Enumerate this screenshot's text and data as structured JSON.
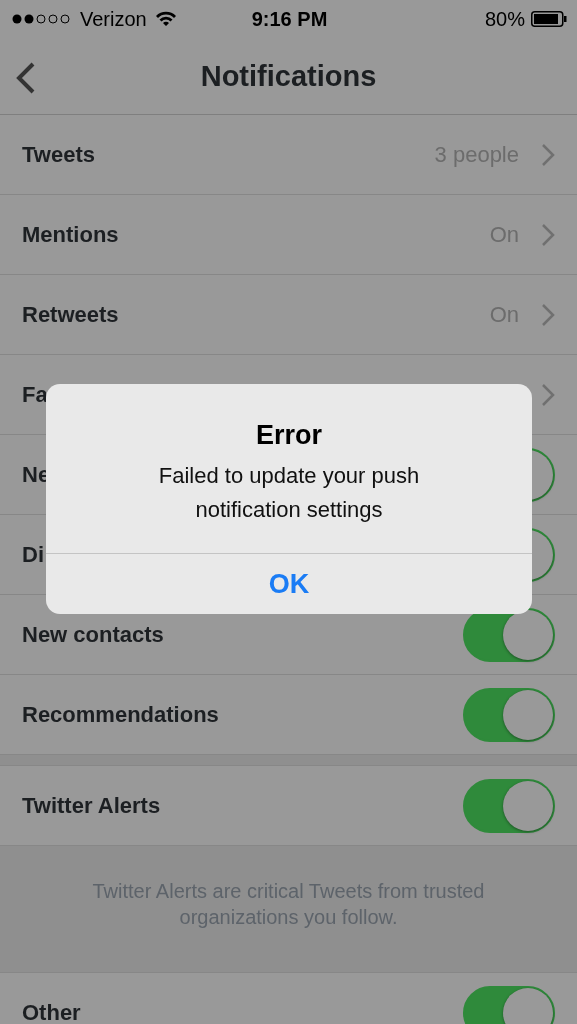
{
  "status_bar": {
    "carrier": "Verizon",
    "time": "9:16 PM",
    "battery": "80%"
  },
  "nav": {
    "title": "Notifications"
  },
  "sections": [
    {
      "rows": [
        {
          "kind": "link",
          "label": "Tweets",
          "value": "3 people"
        },
        {
          "kind": "link",
          "label": "Mentions",
          "value": "On"
        },
        {
          "kind": "link",
          "label": "Retweets",
          "value": "On"
        },
        {
          "kind": "link",
          "label": "Fa"
        },
        {
          "kind": "switch",
          "label": "Ne",
          "on": true
        },
        {
          "kind": "switch",
          "label": "Di",
          "on": true
        },
        {
          "kind": "switch",
          "label": "New contacts",
          "on": true
        },
        {
          "kind": "switch",
          "label": "Recommendations",
          "on": true
        }
      ]
    },
    {
      "rows": [
        {
          "kind": "switch",
          "label": "Twitter Alerts",
          "on": true
        }
      ],
      "footer": "Twitter Alerts are critical Tweets from trusted organizations you follow."
    },
    {
      "rows": [
        {
          "kind": "switch",
          "label": "Other",
          "on": true
        }
      ]
    }
  ],
  "dialog": {
    "title": "Error",
    "message": "Failed to update your push notification settings",
    "button": "OK"
  }
}
